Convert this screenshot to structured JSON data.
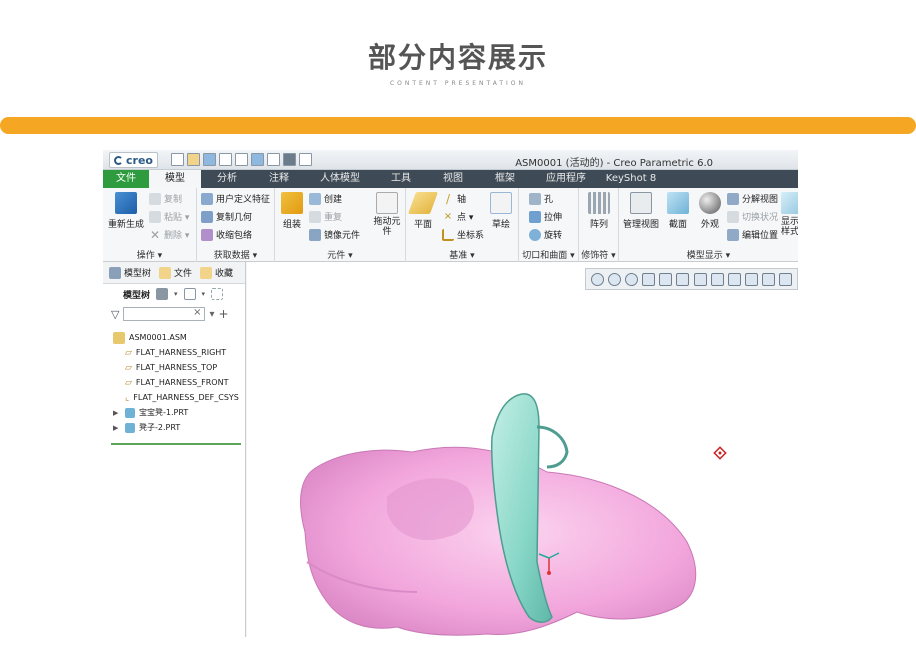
{
  "heading": {
    "title": "部分内容展示",
    "subtitle": "CONTENT PRESENTATION"
  },
  "app": {
    "logo": "creo",
    "window_title": "ASM0001 (活动的) - Creo Parametric 6.0",
    "tabs": [
      "文件",
      "模型",
      "分析",
      "注释",
      "人体模型",
      "工具",
      "视图",
      "框架",
      "应用程序",
      "KeyShot 8"
    ],
    "active_tab": "模型",
    "ribbon": {
      "operations": {
        "label": "操作 ▾",
        "regen": "重新生成",
        "copy": "复制",
        "paste": "粘贴 ▾",
        "delete": "删除 ▾"
      },
      "get_data": {
        "label": "获取数据 ▾",
        "udf": "用户定义特征",
        "copy_geom": "复制几何",
        "shrinkwrap": "收缩包络"
      },
      "component": {
        "label": "元件 ▾",
        "assemble": "组装",
        "create": "创建",
        "repeat": "重复",
        "mirror": "镜像元件",
        "drag": "拖动元件"
      },
      "datum": {
        "label": "基准 ▾",
        "plane": "平面",
        "axis": "轴",
        "point": "点 ▾",
        "csys": "坐标系",
        "sketch": "草绘"
      },
      "cut_surface": {
        "label": "切口和曲面 ▾",
        "hole": "孔",
        "extrude": "拉伸",
        "revolve": "旋转"
      },
      "modifiers": {
        "label": "修饰符 ▾",
        "pattern": "阵列"
      },
      "model_display": {
        "label": "模型显示 ▾",
        "manage_views": "管理视图",
        "section": "截面",
        "appearance": "外观",
        "explode": "分解视图",
        "toggle_status": "切换状况",
        "edit_position": "编辑位置",
        "display_style": "显示样式"
      }
    },
    "model_tree": {
      "tabs": [
        "模型树",
        "文件",
        "收藏"
      ],
      "toolbar_label": "模型树",
      "items": [
        {
          "label": "ASM0001.ASM",
          "level": 0,
          "expandable": false
        },
        {
          "label": "FLAT_HARNESS_RIGHT",
          "level": 1,
          "expandable": false
        },
        {
          "label": "FLAT_HARNESS_TOP",
          "level": 1,
          "expandable": false
        },
        {
          "label": "FLAT_HARNESS_FRONT",
          "level": 1,
          "expandable": false
        },
        {
          "label": "FLAT_HARNESS_DEF_CSYS",
          "level": 1,
          "expandable": false
        },
        {
          "label": "宝宝凳-1.PRT",
          "level": 1,
          "expandable": true
        },
        {
          "label": "凳子-2.PRT",
          "level": 1,
          "expandable": true
        }
      ]
    },
    "colors": {
      "accent_orange": "#f5a623",
      "file_tab": "#2e9c3e",
      "tab_bar": "#3e4a55",
      "model_pink": "#f2a6dc",
      "model_teal": "#86d6c6"
    }
  }
}
